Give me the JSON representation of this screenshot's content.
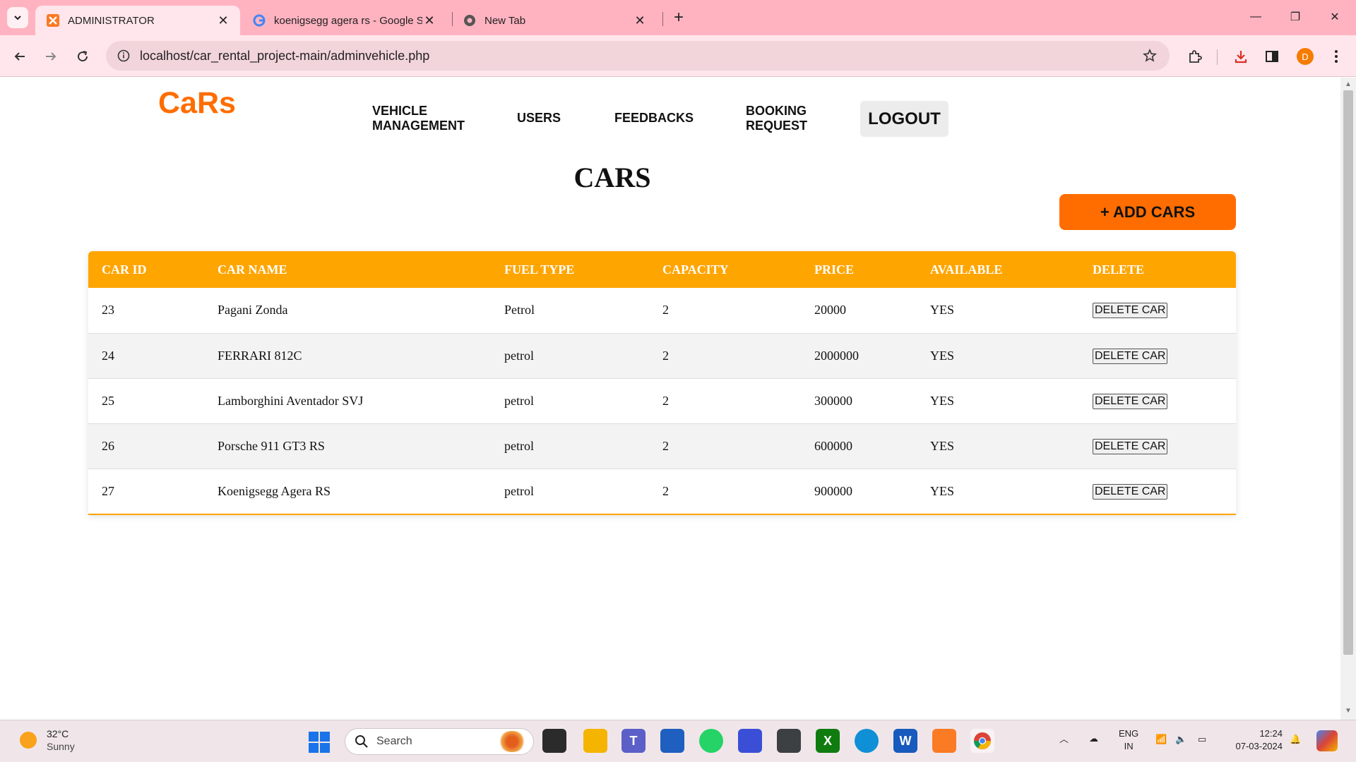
{
  "browser": {
    "tabs": [
      {
        "title": "ADMINISTRATOR",
        "active": true
      },
      {
        "title": "koenigsegg agera rs - Google S",
        "active": false
      },
      {
        "title": "New Tab",
        "active": false
      }
    ],
    "url": "localhost/car_rental_project-main/adminvehicle.php",
    "profile_initial": "D"
  },
  "page": {
    "logo": "CaRs",
    "nav": [
      {
        "line1": "VEHICLE",
        "line2": "MANAGEMENT"
      },
      {
        "line1": "USERS",
        "line2": ""
      },
      {
        "line1": "FEEDBACKS",
        "line2": ""
      },
      {
        "line1": "BOOKING",
        "line2": "REQUEST"
      }
    ],
    "logout_label": "LOGOUT",
    "title": "CARS",
    "add_button_label": "+ ADD CARS",
    "table": {
      "headers": [
        "CAR ID",
        "CAR NAME",
        "FUEL TYPE",
        "CAPACITY",
        "PRICE",
        "AVAILABLE",
        "DELETE"
      ],
      "rows": [
        {
          "id": "23",
          "name": "Pagani Zonda",
          "fuel": "Petrol",
          "capacity": "2",
          "price": "20000",
          "available": "YES",
          "action": "DELETE CAR"
        },
        {
          "id": "24",
          "name": "FERRARI 812C",
          "fuel": "petrol",
          "capacity": "2",
          "price": "2000000",
          "available": "YES",
          "action": "DELETE CAR"
        },
        {
          "id": "25",
          "name": "Lamborghini Aventador SVJ",
          "fuel": "petrol",
          "capacity": "2",
          "price": "300000",
          "available": "YES",
          "action": "DELETE CAR"
        },
        {
          "id": "26",
          "name": "Porsche 911 GT3 RS",
          "fuel": "petrol",
          "capacity": "2",
          "price": "600000",
          "available": "YES",
          "action": "DELETE CAR"
        },
        {
          "id": "27",
          "name": "Koenigsegg Agera RS",
          "fuel": "petrol",
          "capacity": "2",
          "price": "900000",
          "available": "YES",
          "action": "DELETE CAR"
        }
      ]
    }
  },
  "taskbar": {
    "weather_temp": "32°C",
    "weather_condition": "Sunny",
    "search_label": "Search",
    "lang_line1": "ENG",
    "lang_line2": "IN",
    "time": "12:24",
    "date": "07-03-2024"
  },
  "colors": {
    "accent_orange": "#ff6d00",
    "table_header": "#ffa500",
    "tabbar": "#ffb3c1"
  }
}
